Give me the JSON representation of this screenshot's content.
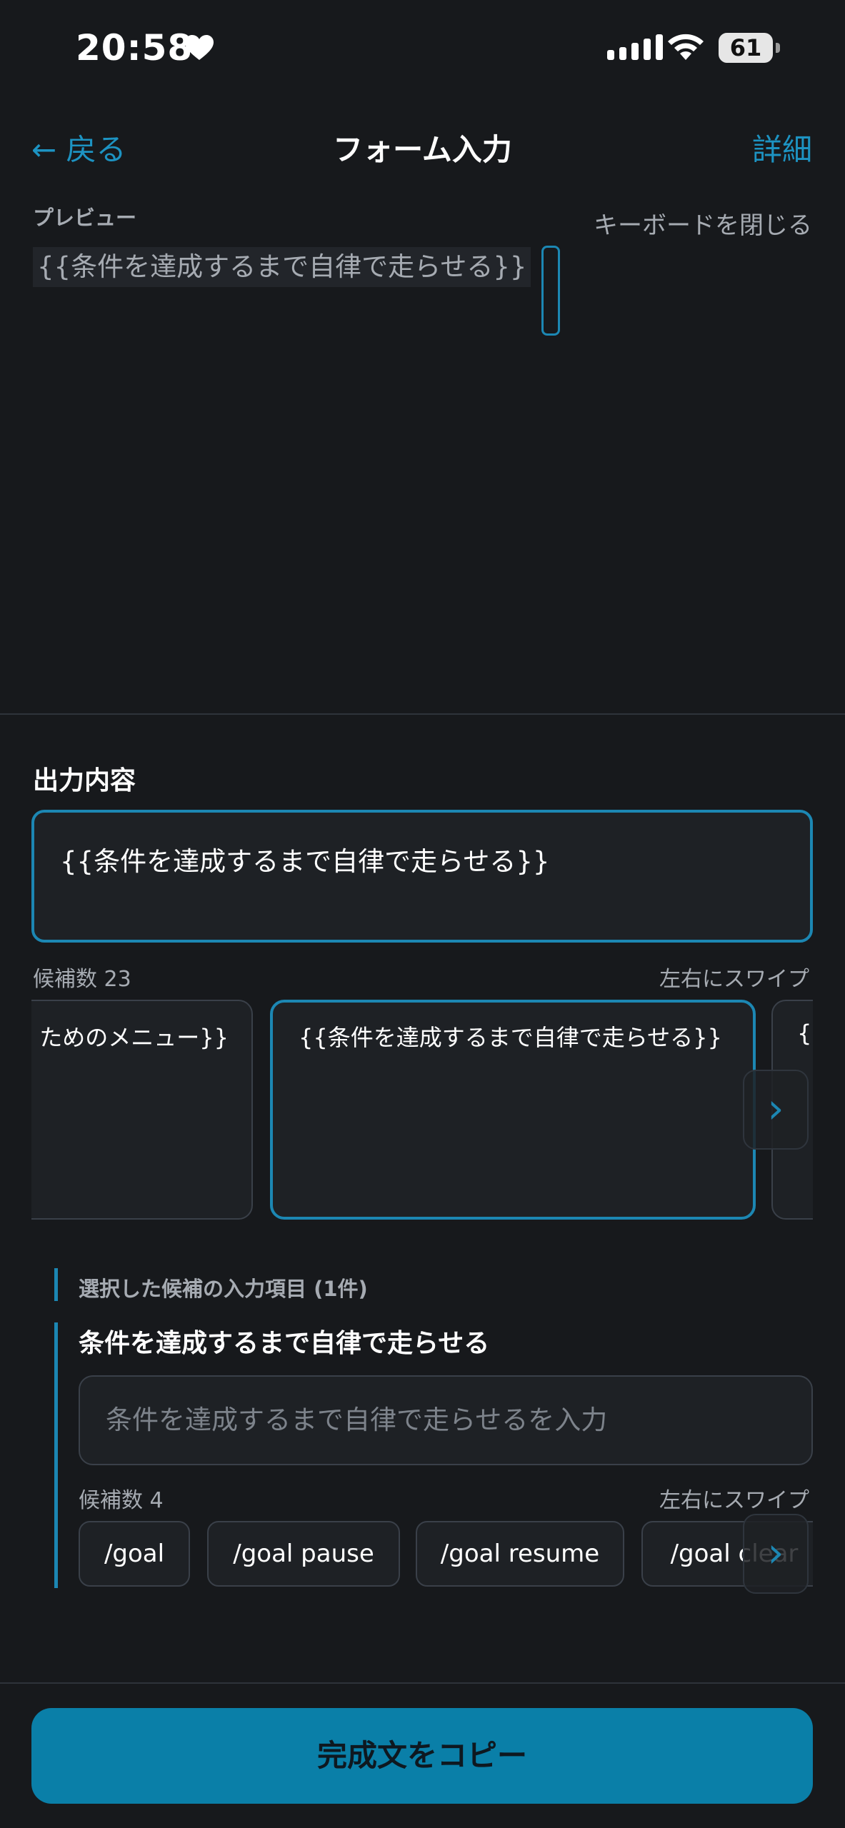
{
  "status_bar": {
    "time": "20:58",
    "battery": "61"
  },
  "header": {
    "back_label": "← 戻る",
    "title": "フォーム入力",
    "detail_label": "詳細"
  },
  "preview": {
    "label": "プレビュー",
    "close_keyboard": "キーボードを閉じる",
    "text": "{{条件を達成するまで自律で走らせる}}"
  },
  "output": {
    "label": "出力内容",
    "value": "{{条件を達成するまで自律で走らせる}}",
    "candidate_count": "候補数 23",
    "swipe_hint": "左右にスワイプ",
    "cards": [
      {
        "text": "ためのメニュー}}"
      },
      {
        "text": "{{条件を達成するまで自律で走らせる}}"
      },
      {
        "text": "{{"
      }
    ]
  },
  "selected": {
    "section_label": "選択した候補の入力項目 (1件)",
    "field_title": "条件を達成するまで自律で走らせる",
    "field_placeholder": "条件を達成するまで自律で走らせるを入力",
    "candidate_count": "候補数 4",
    "swipe_hint": "左右にスワイプ",
    "chips": [
      "/goal",
      "/goal pause",
      "/goal resume",
      "/goal clear"
    ]
  },
  "copy_button": "完成文をコピー",
  "colors": {
    "accent": "#1c87b3",
    "background": "#17191c",
    "button": "#0a7fa8"
  },
  "icons": {
    "next": "chevron-right-icon",
    "heart": "heart-icon",
    "wifi": "wifi-icon"
  }
}
